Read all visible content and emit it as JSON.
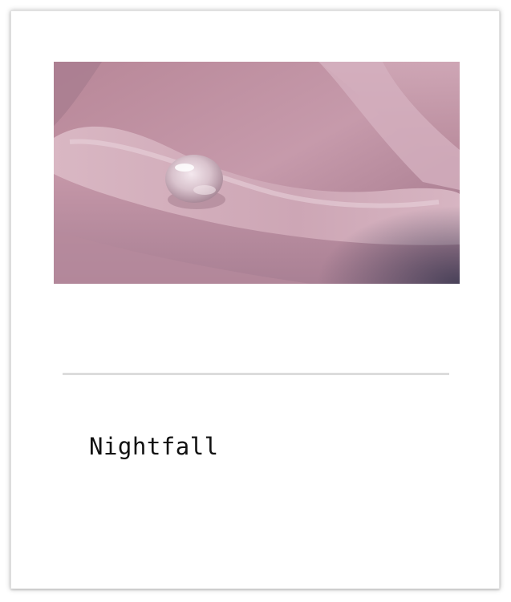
{
  "card": {
    "image": {
      "subject": "pink-rose-petal-with-water-droplet",
      "palette": [
        "#c497a8",
        "#a97c8f",
        "#e6c8d3",
        "#8a6376"
      ]
    },
    "caption": "Nightfall"
  }
}
